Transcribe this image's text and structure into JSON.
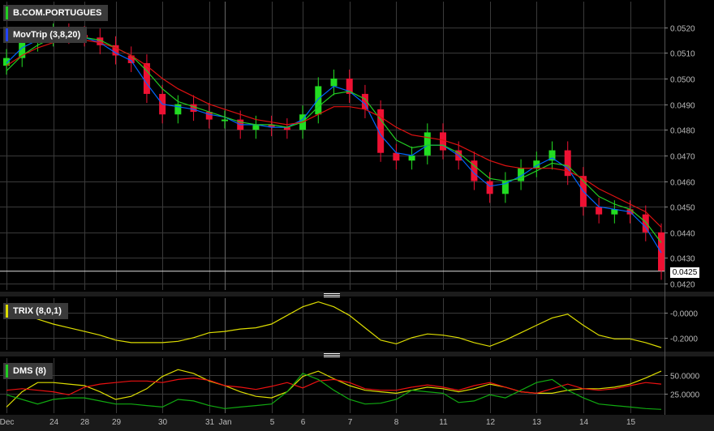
{
  "panels": {
    "price": {
      "label": "B.COM.PORTUGUES",
      "indicator": "MovTrip (3,8,20)",
      "last_value": "0.0425"
    },
    "trix": {
      "label": "TRIX (8,0,1)"
    },
    "dms": {
      "label": "DMS (8)"
    }
  },
  "colors": {
    "up": "#22dd22",
    "down": "#ee1133",
    "ma_fast": "#0066ff",
    "ma_mid": "#22cc22",
    "ma_slow": "#dd1111",
    "trix": "#dddd00",
    "dms_yellow": "#dddd00",
    "dms_red": "#ee1111",
    "dms_green": "#11aa11",
    "grid": "#3a3a3a"
  },
  "chart_data": [
    {
      "type": "candlestick",
      "title": "B.COM.PORTUGUES",
      "y_ticks": [
        "0.0520",
        "0.0510",
        "0.0500",
        "0.0490",
        "0.0480",
        "0.0470",
        "0.0460",
        "0.0450",
        "0.0440",
        "0.0430",
        "0.0420"
      ],
      "ylim": [
        0.04175,
        0.053
      ],
      "x_labels": [
        "Dec",
        "24",
        "28",
        "29",
        "30",
        "31",
        "Jan",
        "5",
        "6",
        "7",
        "8",
        "11",
        "12",
        "13",
        "14",
        "15"
      ],
      "x_label_day_index": [
        0,
        3,
        5,
        7,
        10,
        13,
        14,
        17,
        19,
        22,
        25,
        28,
        31,
        34,
        37,
        40
      ],
      "last_value": 0.0425,
      "closes": [
        0.0508,
        0.0514,
        0.0516,
        0.0518,
        0.0517,
        0.0516,
        0.0513,
        0.0509,
        0.0506,
        0.0494,
        0.0486,
        0.049,
        0.0487,
        0.0484,
        0.0484,
        0.048,
        0.0482,
        0.0481,
        0.048,
        0.0486,
        0.0497,
        0.05,
        0.0494,
        0.0488,
        0.0471,
        0.0468,
        0.047,
        0.0479,
        0.0472,
        0.0468,
        0.046,
        0.0455,
        0.046,
        0.0465,
        0.0468,
        0.0472,
        0.0462,
        0.045,
        0.0447,
        0.0449,
        0.0447,
        0.044,
        0.0425
      ],
      "series": [
        {
          "name": "MovTrip 3",
          "values": [
            0.0506,
            0.0512,
            0.0515,
            0.0517,
            0.0517,
            0.0516,
            0.0514,
            0.051,
            0.0507,
            0.0498,
            0.049,
            0.0489,
            0.0488,
            0.0486,
            0.0485,
            0.0482,
            0.0482,
            0.0481,
            0.0481,
            0.0484,
            0.0492,
            0.0497,
            0.0495,
            0.049,
            0.0478,
            0.0471,
            0.047,
            0.0474,
            0.0474,
            0.047,
            0.0463,
            0.0458,
            0.0459,
            0.0462,
            0.0466,
            0.0469,
            0.0465,
            0.0456,
            0.045,
            0.0449,
            0.0448,
            0.0442,
            0.0432
          ]
        },
        {
          "name": "MovTrip 8",
          "values": [
            0.0503,
            0.0509,
            0.0513,
            0.0516,
            0.0517,
            0.0516,
            0.0515,
            0.0512,
            0.0509,
            0.0503,
            0.0496,
            0.0491,
            0.0489,
            0.0487,
            0.0485,
            0.0483,
            0.0482,
            0.0482,
            0.0481,
            0.0483,
            0.0489,
            0.0494,
            0.0495,
            0.0492,
            0.0484,
            0.0476,
            0.0473,
            0.0474,
            0.0474,
            0.0471,
            0.0466,
            0.0461,
            0.046,
            0.0461,
            0.0464,
            0.0467,
            0.0466,
            0.046,
            0.0454,
            0.0451,
            0.0449,
            0.0444,
            0.0436
          ]
        },
        {
          "name": "MovTrip 20",
          "values": [
            0.0505,
            0.0509,
            0.0512,
            0.0514,
            0.0515,
            0.0515,
            0.0514,
            0.0512,
            0.0509,
            0.0505,
            0.05,
            0.0496,
            0.0493,
            0.049,
            0.0488,
            0.0486,
            0.0484,
            0.0483,
            0.0482,
            0.0483,
            0.0486,
            0.0489,
            0.0489,
            0.0488,
            0.0485,
            0.0481,
            0.0478,
            0.0477,
            0.0476,
            0.0474,
            0.0471,
            0.0468,
            0.0466,
            0.0465,
            0.0465,
            0.0465,
            0.0464,
            0.0461,
            0.0457,
            0.0454,
            0.0451,
            0.0448,
            0.0442
          ]
        }
      ]
    },
    {
      "type": "line",
      "title": "TRIX (8,0,1)",
      "y_ticks": [
        "-0.0000",
        "-0.2000"
      ],
      "ylim": [
        -0.3,
        0.12
      ],
      "series": [
        {
          "name": "TRIX",
          "values": [
            0.05,
            0.0,
            -0.05,
            -0.09,
            -0.12,
            -0.15,
            -0.18,
            -0.22,
            -0.24,
            -0.24,
            -0.24,
            -0.23,
            -0.2,
            -0.16,
            -0.15,
            -0.13,
            -0.12,
            -0.09,
            -0.02,
            0.05,
            0.09,
            0.05,
            -0.02,
            -0.12,
            -0.22,
            -0.25,
            -0.2,
            -0.17,
            -0.18,
            -0.2,
            -0.24,
            -0.27,
            -0.22,
            -0.16,
            -0.1,
            -0.04,
            -0.01,
            -0.1,
            -0.18,
            -0.21,
            -0.21,
            -0.24,
            -0.28
          ]
        }
      ]
    },
    {
      "type": "line",
      "title": "DMS (8)",
      "y_ticks": [
        "50.0000",
        "25.0000"
      ],
      "ylim": [
        0,
        72
      ],
      "series": [
        {
          "name": "DMS yellow",
          "values": [
            8,
            28,
            40,
            40,
            38,
            36,
            28,
            18,
            22,
            32,
            48,
            57,
            52,
            42,
            36,
            28,
            22,
            20,
            28,
            48,
            55,
            45,
            36,
            30,
            28,
            26,
            30,
            34,
            32,
            28,
            32,
            38,
            34,
            28,
            26,
            26,
            30,
            32,
            32,
            34,
            38,
            46,
            55
          ]
        },
        {
          "name": "DMS red",
          "values": [
            30,
            32,
            30,
            28,
            24,
            34,
            38,
            40,
            42,
            42,
            40,
            44,
            46,
            43,
            36,
            34,
            31,
            35,
            40,
            33,
            42,
            44,
            40,
            32,
            30,
            30,
            34,
            37,
            34,
            30,
            36,
            40,
            34,
            28,
            26,
            32,
            38,
            32,
            30,
            32,
            36,
            40,
            38
          ]
        },
        {
          "name": "DMS green",
          "values": [
            24,
            18,
            12,
            18,
            20,
            20,
            16,
            12,
            12,
            10,
            8,
            18,
            16,
            10,
            6,
            8,
            10,
            12,
            28,
            52,
            44,
            30,
            18,
            12,
            13,
            18,
            30,
            28,
            26,
            14,
            16,
            24,
            20,
            30,
            40,
            44,
            30,
            20,
            12,
            10,
            8,
            6,
            5
          ]
        }
      ]
    }
  ]
}
